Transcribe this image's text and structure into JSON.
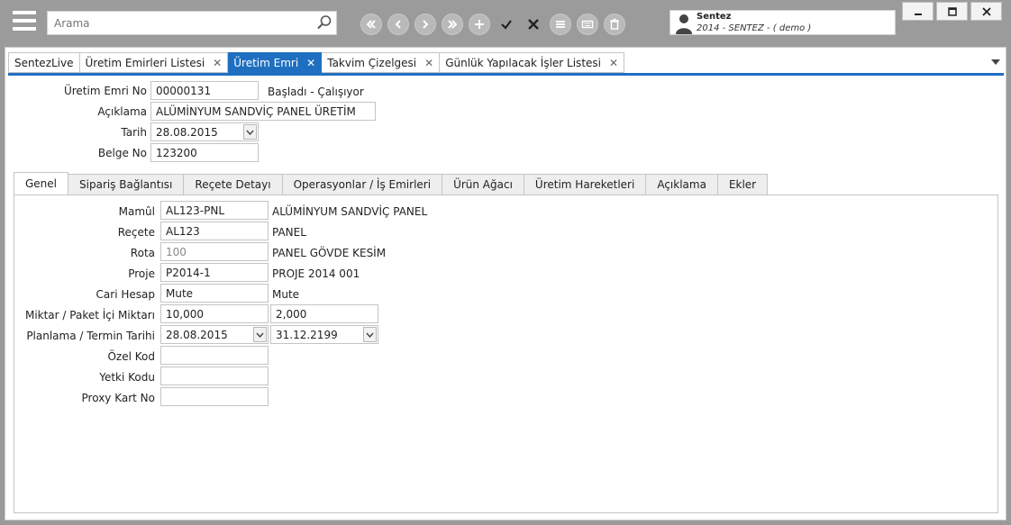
{
  "toolbar": {
    "search_placeholder": "Arama",
    "nav_buttons": [
      "first-icon",
      "previous-icon",
      "next-icon",
      "last-icon",
      "add-icon",
      "confirm-icon",
      "cancel-icon",
      "list-icon",
      "keyboard-icon",
      "delete-icon"
    ]
  },
  "user": {
    "name": "Sentez",
    "subtitle": "2014 - SENTEZ - ( demo )"
  },
  "tabs": [
    {
      "label": "SentezLive",
      "closable": false,
      "active": false
    },
    {
      "label": "Üretim Emirleri Listesi",
      "closable": true,
      "active": false
    },
    {
      "label": "Üretim Emri",
      "closable": true,
      "active": true
    },
    {
      "label": "Takvim Çizelgesi",
      "closable": true,
      "active": false
    },
    {
      "label": "Günlük Yapılacak İşler Listesi",
      "closable": true,
      "active": false
    }
  ],
  "header": {
    "order_no_label": "Üretim Emri No",
    "order_no": "00000131",
    "status": "Başladı - Çalışıyor",
    "description_label": "Açıklama",
    "description": "ALÜMİNYUM SANDVİÇ PANEL ÜRETİM",
    "date_label": "Tarih",
    "date": "28.08.2015",
    "doc_no_label": "Belge No",
    "doc_no": "123200"
  },
  "inner_tabs": [
    "Genel",
    "Sipariş Bağlantısı",
    "Reçete Detayı",
    "Operasyonlar / İş Emirleri",
    "Ürün Ağacı",
    "Üretim Hareketleri",
    "Açıklama",
    "Ekler"
  ],
  "general": {
    "product_label": "Mamûl",
    "product_code": "AL123-PNL",
    "product_name": "ALÜMİNYUM SANDVİÇ PANEL",
    "recipe_label": "Reçete",
    "recipe_code": "AL123",
    "recipe_name": "PANEL",
    "route_label": "Rota",
    "route_code": "100",
    "route_name": "PANEL GÖVDE KESİM",
    "project_label": "Proje",
    "project_code": "P2014-1",
    "project_name": "PROJE 2014 001",
    "account_label": "Cari Hesap",
    "account_code": "Mute",
    "account_name": "Mute",
    "qty_label": "Miktar / Paket İçi Miktarı",
    "qty": "10,000",
    "pack_qty": "2,000",
    "plan_label": "Planlama / Termin Tarihi",
    "plan_date": "28.08.2015",
    "due_date": "31.12.2199",
    "special_code_label": "Özel Kod",
    "special_code": "",
    "auth_code_label": "Yetki Kodu",
    "auth_code": "",
    "proxy_card_label": "Proxy Kart No",
    "proxy_card": ""
  },
  "colors": {
    "accent": "#1f6fc1",
    "topbar": "#9b9b9b"
  }
}
